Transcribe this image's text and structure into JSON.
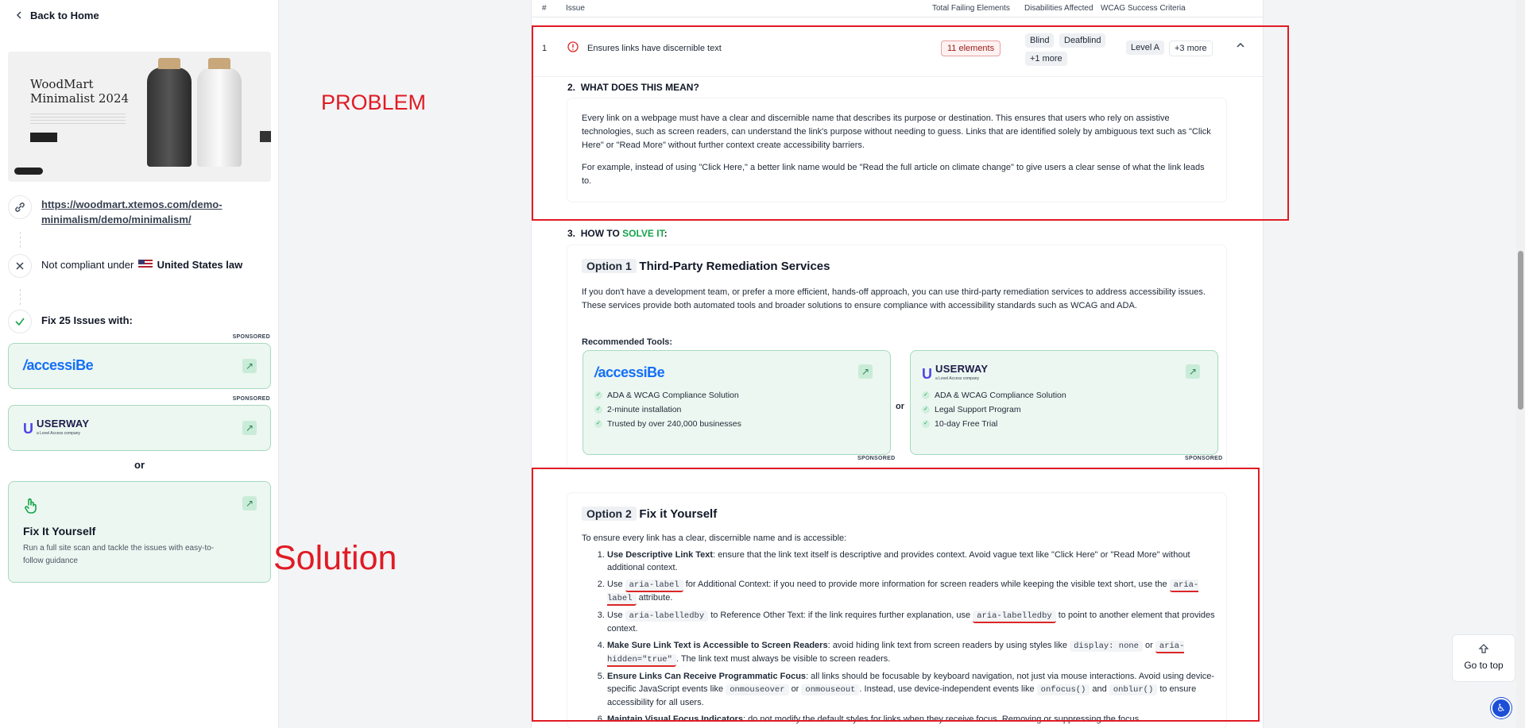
{
  "sidebar": {
    "back_label": "Back to Home",
    "preview": {
      "title": "WoodMart Minimalist 2024"
    },
    "url": "https://woodmart.xtemos.com/demo-minimalism/demo/minimalism/",
    "compliance": {
      "prefix": "Not compliant under",
      "country": "United States law"
    },
    "fix_label": "Fix 25 Issues with:",
    "sponsored_label": "SPONSORED",
    "tools": [
      {
        "name": "accessiBe",
        "icon": "arrow-up-right-icon"
      },
      {
        "name": "USERWAY",
        "tagline": "a Level Access company",
        "icon": "arrow-up-right-icon"
      }
    ],
    "or_label": "or",
    "diy": {
      "title": "Fix It Yourself",
      "description": "Run a full site scan and tackle the issues with easy-to-follow guidance"
    }
  },
  "table": {
    "headers": [
      "#",
      "Issue",
      "Total Failing Elements",
      "Disabilities Affected",
      "WCAG Success Criteria"
    ],
    "row": {
      "index": "1",
      "issue": "Ensures links have discernible text",
      "failing": "11 elements",
      "disabilities": [
        "Blind",
        "Deafblind",
        "+1 more"
      ],
      "level": "Level A",
      "more": "+3 more"
    }
  },
  "meaning": {
    "heading_num": "2.",
    "heading": "WHAT DOES THIS MEAN?",
    "p1": "Every link on a webpage must have a clear and discernible name that describes its purpose or destination. This ensures that users who rely on assistive technologies, such as screen readers, can understand the link's purpose without needing to guess. Links that are identified solely by ambiguous text such as \"Click Here\" or \"Read More\" without further context create accessibility barriers.",
    "p2": "For example, instead of using \"Click Here,\" a better link name would be \"Read the full article on climate change\" to give users a clear sense of what the link leads to."
  },
  "solve": {
    "heading_num": "3.",
    "heading_pre": "HOW TO",
    "heading_green": "SOLVE IT",
    "heading_post": ":",
    "option1": {
      "tag": "Option 1",
      "title": "Third-Party Remediation Services",
      "body": "If you don't have a development team, or prefer a more efficient, hands-off approach, you can use third-party remediation services to address accessibility issues. These services provide both automated tools and broader solutions to ensure compliance with accessibility standards such as WCAG and ADA.",
      "recommended": "Recommended Tools:",
      "or": "or",
      "sponsored": "SPONSORED",
      "cards": [
        {
          "name": "accessiBe",
          "features": [
            "ADA & WCAG Compliance Solution",
            "2-minute installation",
            "Trusted by over 240,000 businesses"
          ]
        },
        {
          "name": "USERWAY",
          "tagline": "a Level Access company",
          "features": [
            "ADA & WCAG Compliance Solution",
            "Legal Support Program",
            "10-day Free Trial"
          ]
        }
      ]
    },
    "option2": {
      "tag": "Option 2",
      "title": "Fix it Yourself",
      "intro": "To ensure every link has a clear, discernible name and is accessible:",
      "items": [
        {
          "bold": "Use Descriptive Link Text",
          "text": ": ensure that the link text itself is descriptive and provides context. Avoid vague text like \"Click Here\" or \"Read More\" without additional context."
        },
        {
          "pre": "Use",
          "code1": "aria-label",
          "mid": "for Additional Context: if you need to provide more information for screen readers while keeping the visible text short, use the",
          "code2": "aria-label",
          "post": "attribute."
        },
        {
          "pre": "Use",
          "code1": "aria-labelledby",
          "mid": "to Reference Other Text: if the link requires further explanation, use",
          "code2": "aria-labelledby",
          "post": "to point to another element that provides context."
        },
        {
          "bold": "Make Sure Link Text is Accessible to Screen Readers",
          "text": ": avoid hiding link text from screen readers by using styles like",
          "code1": "display: none",
          "mid": "or",
          "code2": "aria-hidden=\"true\"",
          "post": ". The link text must always be visible to screen readers."
        },
        {
          "bold": "Ensure Links Can Receive Programmatic Focus",
          "text": ": all links should be focusable by keyboard navigation, not just via mouse interactions. Avoid using device-specific JavaScript events like",
          "code1": "onmouseover",
          "mid": "or",
          "code2": "onmouseout",
          "mid2": ". Instead, use device-independent events like",
          "code3": "onfocus()",
          "mid3": "and",
          "code4": "onblur()",
          "post": "to ensure accessibility for all users."
        },
        {
          "bold": "Maintain Visual Focus Indicators",
          "text": ": do not modify the default styles for links when they receive focus. Removing or suppressing the focus"
        }
      ]
    }
  },
  "annotations": {
    "problem": "PROBLEM",
    "solution": "Solution",
    "color": "#e01b24"
  },
  "go_top": "Go to top",
  "colors": {
    "accent_green": "#16a34a",
    "card_bg": "#ecf7f1",
    "accessibe_blue": "#146ff8"
  }
}
